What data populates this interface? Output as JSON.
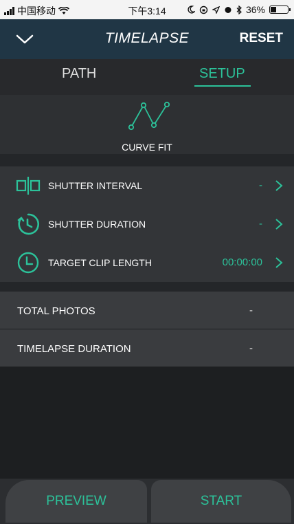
{
  "status_bar": {
    "carrier": "中国移动",
    "time": "下午3:14",
    "battery": "36%",
    "battery_level": 0.36
  },
  "nav": {
    "title": "TIMELAPSE",
    "reset_label": "RESET",
    "back_icon": "chevron-down-icon"
  },
  "tabs": {
    "items": [
      {
        "label": "PATH",
        "active": false
      },
      {
        "label": "SETUP",
        "active": true
      }
    ]
  },
  "curve": {
    "label": "CURVE FIT",
    "icon": "curve-fit-icon"
  },
  "settings": [
    {
      "label": "SHUTTER INTERVAL",
      "value": "-",
      "icon": "shutter-interval-icon"
    },
    {
      "label": "SHUTTER DURATION",
      "value": "-",
      "icon": "shutter-duration-icon"
    },
    {
      "label": "TARGET CLIP LENGTH",
      "value": "00:00:00",
      "icon": "clock-icon"
    }
  ],
  "summary": [
    {
      "label": "TOTAL PHOTOS",
      "value": "-"
    },
    {
      "label": "TIMELAPSE DURATION",
      "value": "-"
    }
  ],
  "buttons": {
    "preview_label": "PREVIEW",
    "start_label": "START"
  },
  "colors": {
    "accent": "#2cc29a",
    "nav_bg": "#203645",
    "background": "#1d1f21"
  }
}
